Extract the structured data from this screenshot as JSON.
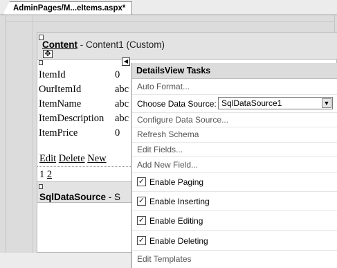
{
  "tab": {
    "title": "AdminPages/M...eItems.aspx*"
  },
  "content": {
    "name": "Content",
    "id_text": " - Content1 (Custom)"
  },
  "details_view": {
    "rows": [
      {
        "field": "ItemId",
        "value": "0"
      },
      {
        "field": "OurItemId",
        "value": "abc"
      },
      {
        "field": "ItemName",
        "value": "abc"
      },
      {
        "field": "ItemDescription",
        "value": "abc"
      },
      {
        "field": "ItemPrice",
        "value": "0"
      }
    ],
    "commands": {
      "edit": "Edit",
      "delete": "Delete",
      "new": "New"
    },
    "pager": {
      "page1": "1",
      "page2": "2"
    }
  },
  "sql_data_source": {
    "name": "SqlDataSource",
    "id_text": " - S"
  },
  "tasks_panel": {
    "title": "DetailsView Tasks",
    "auto_format": "Auto Format...",
    "choose_data_source_label": "Choose Data Source:",
    "data_source_value": "SqlDataSource1",
    "configure_data_source": "Configure Data Source...",
    "refresh_schema": "Refresh Schema",
    "edit_fields": "Edit Fields...",
    "add_new_field": "Add New Field...",
    "enable_paging": "Enable Paging",
    "enable_inserting": "Enable Inserting",
    "enable_editing": "Enable Editing",
    "enable_deleting": "Enable Deleting",
    "edit_templates": "Edit Templates"
  }
}
